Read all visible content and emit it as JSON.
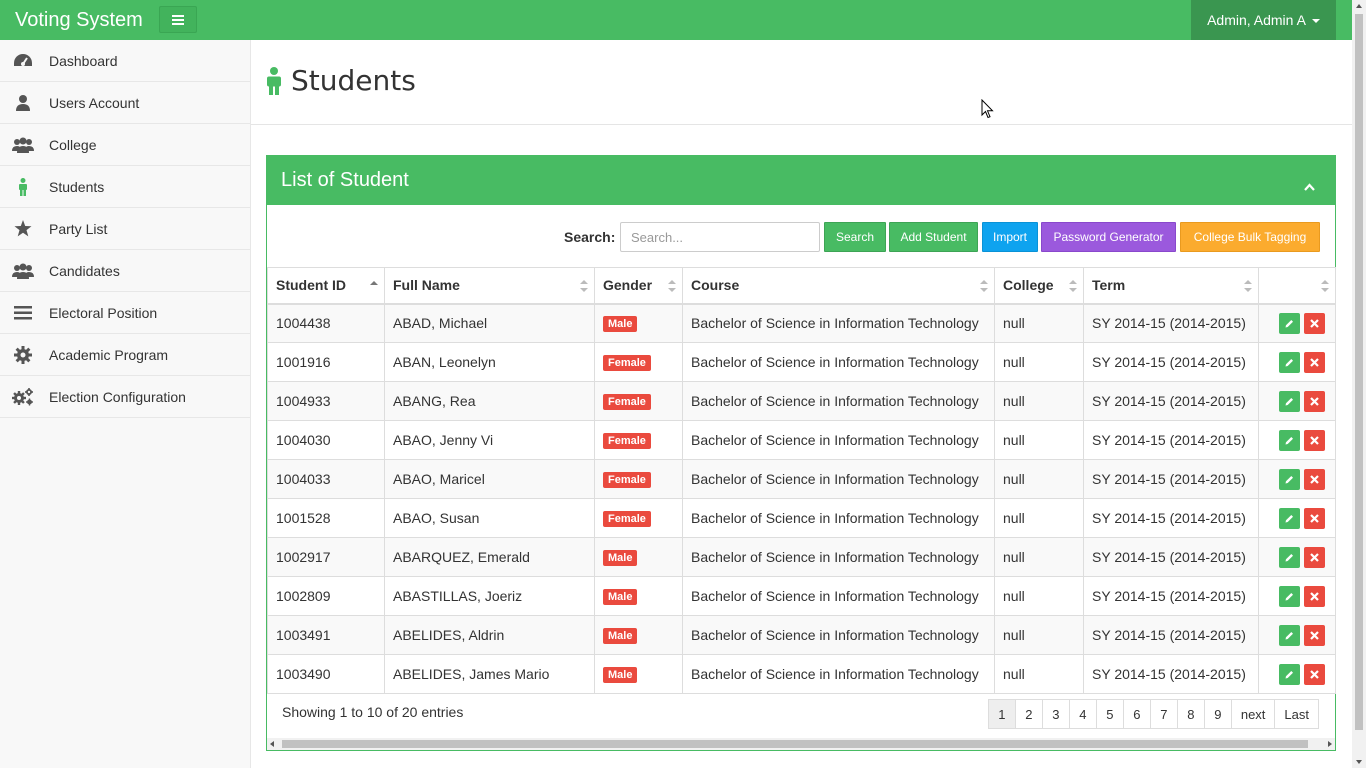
{
  "app": {
    "brand": "Voting System",
    "user_label": "Admin, Admin A"
  },
  "sidebar": {
    "items": [
      {
        "label": "Dashboard",
        "icon": "dashboard-icon"
      },
      {
        "label": "Users Account",
        "icon": "user-icon"
      },
      {
        "label": "College",
        "icon": "users-icon"
      },
      {
        "label": "Students",
        "icon": "male-icon",
        "active": true
      },
      {
        "label": "Party List",
        "icon": "star-icon"
      },
      {
        "label": "Candidates",
        "icon": "users-icon"
      },
      {
        "label": "Electoral Position",
        "icon": "bars-icon"
      },
      {
        "label": "Academic Program",
        "icon": "gear-icon"
      },
      {
        "label": "Election Configuration",
        "icon": "gears-icon"
      }
    ]
  },
  "page": {
    "title": "Students"
  },
  "panel": {
    "title": "List of Student",
    "search_label": "Search:",
    "search_placeholder": "Search...",
    "buttons": {
      "search": "Search",
      "add": "Add Student",
      "import": "Import",
      "password": "Password Generator",
      "bulk": "College Bulk Tagging"
    }
  },
  "table": {
    "columns": [
      "Student ID",
      "Full Name",
      "Gender",
      "Course",
      "College",
      "Term",
      ""
    ],
    "rows": [
      {
        "id": "1004438",
        "name": "ABAD, Michael",
        "gender": "Male",
        "course": "Bachelor of Science in Information Technology",
        "college": "null",
        "term": "SY 2014-15 (2014-2015)"
      },
      {
        "id": "1001916",
        "name": "ABAN, Leonelyn",
        "gender": "Female",
        "course": "Bachelor of Science in Information Technology",
        "college": "null",
        "term": "SY 2014-15 (2014-2015)"
      },
      {
        "id": "1004933",
        "name": "ABANG, Rea",
        "gender": "Female",
        "course": "Bachelor of Science in Information Technology",
        "college": "null",
        "term": "SY 2014-15 (2014-2015)"
      },
      {
        "id": "1004030",
        "name": "ABAO, Jenny Vi",
        "gender": "Female",
        "course": "Bachelor of Science in Information Technology",
        "college": "null",
        "term": "SY 2014-15 (2014-2015)"
      },
      {
        "id": "1004033",
        "name": "ABAO, Maricel",
        "gender": "Female",
        "course": "Bachelor of Science in Information Technology",
        "college": "null",
        "term": "SY 2014-15 (2014-2015)"
      },
      {
        "id": "1001528",
        "name": "ABAO, Susan",
        "gender": "Female",
        "course": "Bachelor of Science in Information Technology",
        "college": "null",
        "term": "SY 2014-15 (2014-2015)"
      },
      {
        "id": "1002917",
        "name": "ABARQUEZ, Emerald",
        "gender": "Male",
        "course": "Bachelor of Science in Information Technology",
        "college": "null",
        "term": "SY 2014-15 (2014-2015)"
      },
      {
        "id": "1002809",
        "name": "ABASTILLAS, Joeriz",
        "gender": "Male",
        "course": "Bachelor of Science in Information Technology",
        "college": "null",
        "term": "SY 2014-15 (2014-2015)"
      },
      {
        "id": "1003491",
        "name": "ABELIDES, Aldrin",
        "gender": "Male",
        "course": "Bachelor of Science in Information Technology",
        "college": "null",
        "term": "SY 2014-15 (2014-2015)"
      },
      {
        "id": "1003490",
        "name": "ABELIDES, James Mario",
        "gender": "Male",
        "course": "Bachelor of Science in Information Technology",
        "college": "null",
        "term": "SY 2014-15 (2014-2015)"
      }
    ]
  },
  "footer": {
    "info": "Showing 1 to 10 of 20 entries",
    "pages": [
      "1",
      "2",
      "3",
      "4",
      "5",
      "6",
      "7",
      "8",
      "9",
      "next",
      "Last"
    ],
    "active_page": "1"
  },
  "colors": {
    "primary": "#48bb63",
    "danger": "#ea4a3e",
    "info": "#0ea3ef",
    "purple": "#9b59dd",
    "warning": "#fbab2e"
  }
}
